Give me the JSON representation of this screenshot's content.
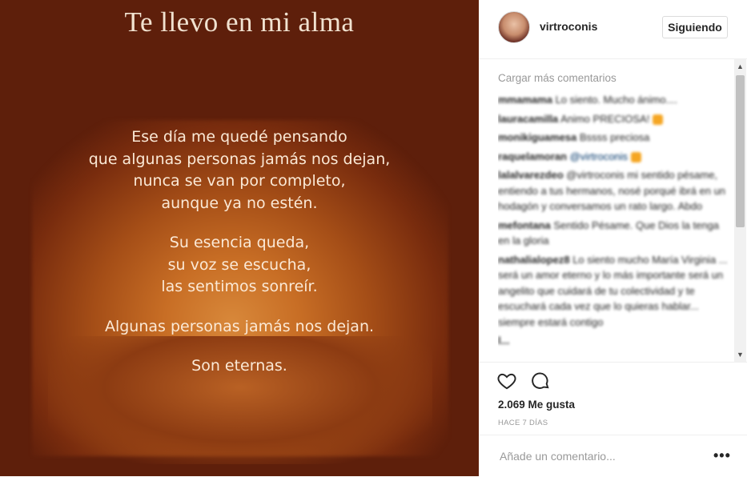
{
  "post_image": {
    "title": "Te llevo en mi alma",
    "stanzas": [
      [
        "Ese día me quedé pensando",
        "que algunas personas jamás nos dejan,",
        "nunca se van por completo,",
        "aunque ya no estén."
      ],
      [
        "Su esencia queda,",
        "su voz se escucha,",
        "las sentimos sonreír."
      ],
      [
        "Algunas personas jamás nos dejan."
      ],
      [
        "Son eternas."
      ]
    ]
  },
  "header": {
    "username": "virtroconis",
    "follow_label": "Siguiendo"
  },
  "comments": {
    "load_more": "Cargar más comentarios",
    "items": [
      {
        "user": "mmamama",
        "text": "Lo siento. Mucho ánimo...."
      },
      {
        "user": "lauracamilla",
        "text": "Animo PRECIOSA!"
      },
      {
        "user": "monikiguamesa",
        "text": "Bssss preciosa"
      },
      {
        "user": "raquelamoran",
        "text": "@virtroconis"
      },
      {
        "user": "lalalvarezdeo",
        "text": "@virtroconis mi sentido pésame, entiendo a tus hermanos, nosé porqué ibrá en un hodagón y conversamos un rato largo. Abdo"
      },
      {
        "user": "mefontana",
        "text": "Sentido Pésame. Que Dios la tenga en la gloria"
      },
      {
        "user": "nathalialopez8",
        "text": "Lo siento mucho María Virginia ... será un amor eterno y lo más importante será un angelito que cuidará de tu colectividad y te escuchará cada vez que lo quieras hablar... siempre estará contigo"
      },
      {
        "user": "l...",
        "text": ""
      }
    ]
  },
  "actions": {
    "like_icon": "heart-outline-icon",
    "comment_icon": "speech-bubble-icon",
    "likes_text": "2.069 Me gusta",
    "time_text": "HACE 7 DÍAS"
  },
  "add_comment": {
    "placeholder": "Añade un comentario...",
    "more_label": "•••"
  },
  "colors": {
    "bg_dark": "#5e1f0b",
    "glow": "#d8883a",
    "poem_text": "#fbe9d6",
    "mention": "#003569"
  }
}
